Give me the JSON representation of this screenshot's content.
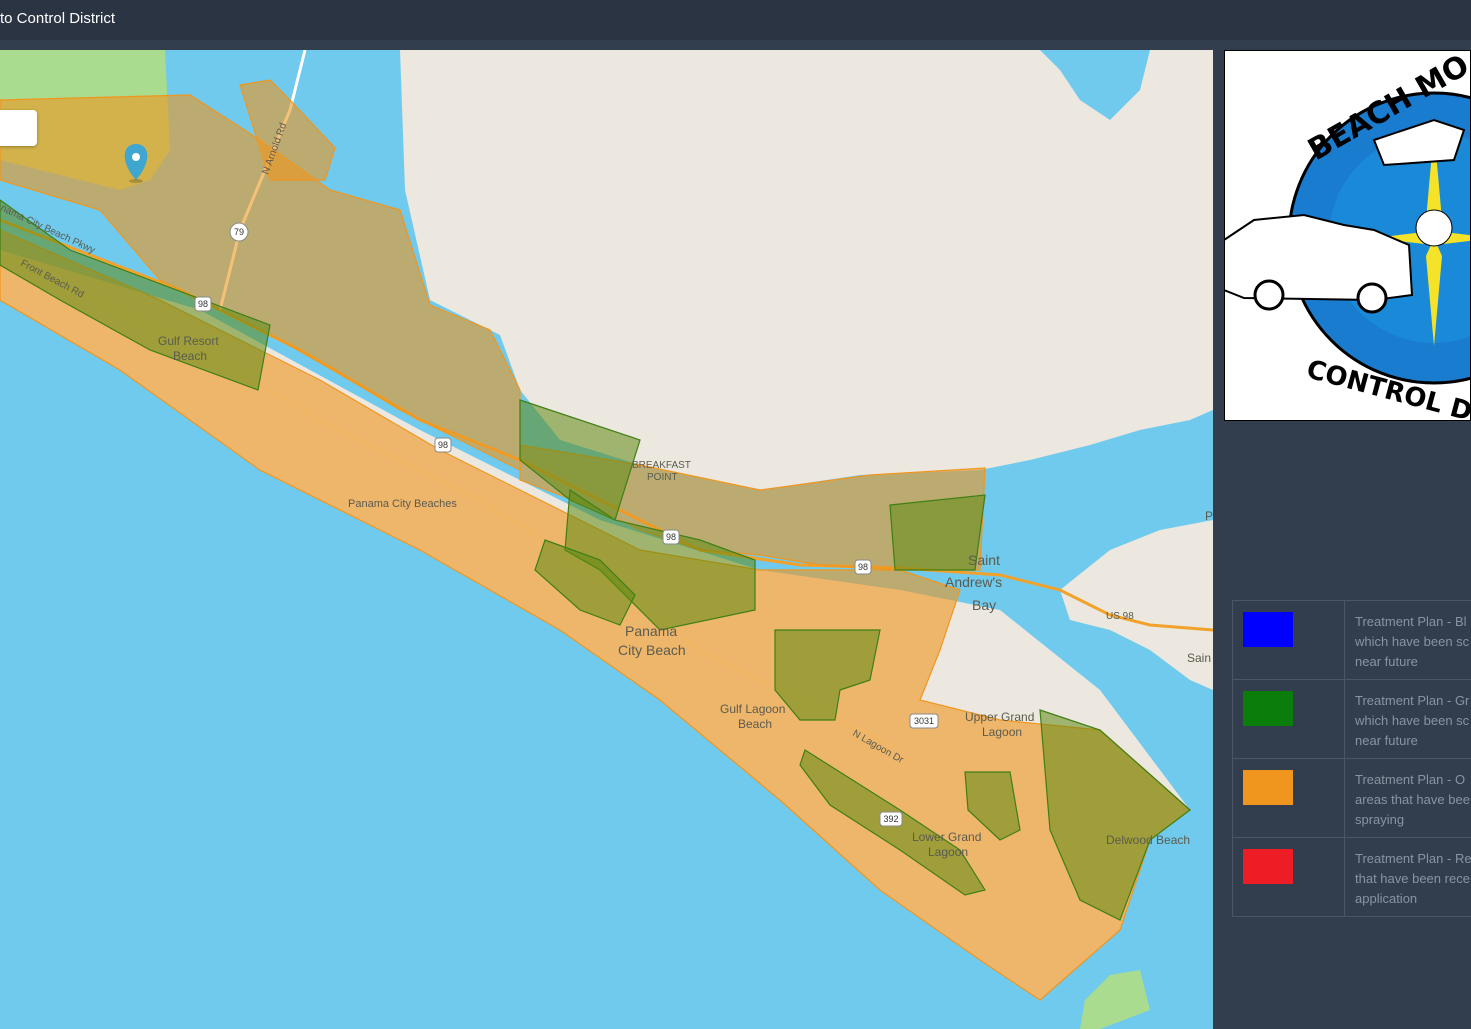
{
  "header": {
    "title": "to Control District"
  },
  "map": {
    "labels": {
      "gulf_resort_1": "Gulf Resort",
      "gulf_resort_2": "Beach",
      "pc_beaches": "Panama City Beaches",
      "breakfast_1": "BREAKFAST",
      "breakfast_2": "POINT",
      "saint_1": "Saint",
      "saint_2": "Andrew's",
      "saint_3": "Bay",
      "pcb_1": "Panama",
      "pcb_2": "City Beach",
      "glb_1": "Gulf Lagoon",
      "glb_2": "Beach",
      "ugl_1": "Upper Grand",
      "ugl_2": "Lagoon",
      "lgl_1": "Lower Grand",
      "lgl_2": "Lagoon",
      "delwood": "Delwood Beach",
      "us98": "US 98",
      "sain": "Sain",
      "p": "P",
      "front_beach_rd": "Front Beach Rd",
      "pcb_pkwy": "nama City Beach Pkwy",
      "n_arnold_rd": "N Arnold Rd",
      "n_lagoon_dr": "N Lagoon Dr"
    },
    "shields": {
      "s79": "79",
      "s98a": "98",
      "s98b": "98",
      "s98c": "98",
      "s98d": "98",
      "s98e": "98",
      "s3031": "3031",
      "s392": "392"
    }
  },
  "logo": {
    "top_text": "BEACH MO",
    "bottom_text": "CONTROL D"
  },
  "legend": {
    "items": [
      {
        "color": "#0000ff",
        "text": "Treatment Plan - Bl\nwhich have been sc\nnear future"
      },
      {
        "color": "#0a7d0a",
        "text": "Treatment Plan - Gr\nwhich have been sc\nnear future"
      },
      {
        "color": "#f0961e",
        "text": "Treatment Plan - O\nareas that have bee\nspraying"
      },
      {
        "color": "#ee1c25",
        "text": "Treatment Plan - Re\nthat have been rece\napplication"
      }
    ]
  },
  "colors": {
    "water": "#6fcaed",
    "land": "#ece7df",
    "orange_zone": "#f0961e",
    "green_zone": "#6a8f1a",
    "marker": "#3ea6cf"
  }
}
